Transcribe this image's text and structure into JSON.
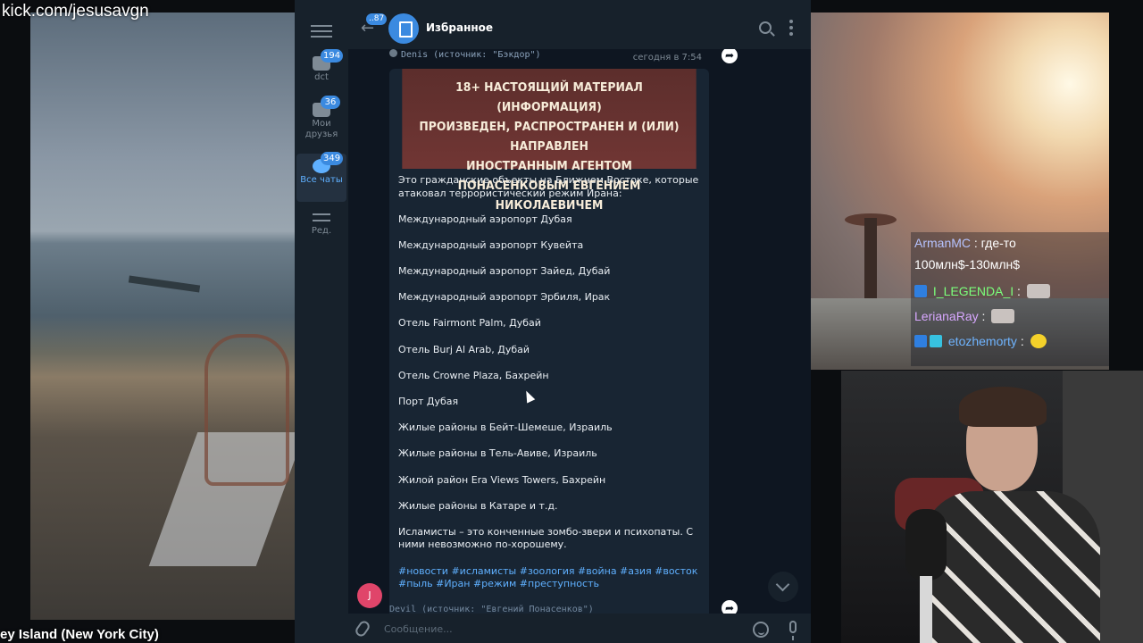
{
  "overlay": {
    "kick_url": "kick.com/jesusavgn",
    "camera_caption": "ey Island (New York City)"
  },
  "stream_chat": [
    {
      "user": "ArmanMC",
      "text": ": где-то"
    },
    {
      "user": "",
      "text": "100млн$-130млн$"
    },
    {
      "user": "I_LEGENDA_I",
      "text": ":"
    },
    {
      "user": "LerianaRay",
      "text": ":"
    },
    {
      "user": "etozhemorty",
      "text": ":"
    }
  ],
  "telegram": {
    "header": {
      "title": "Избранное",
      "back_count": "..87"
    },
    "sidebar": {
      "folders": [
        {
          "label": "dct",
          "count": "194"
        },
        {
          "label": "Мои друзья",
          "count": "36"
        },
        {
          "label": "Все чаты",
          "count": "349"
        },
        {
          "label": "Ред.",
          "count": ""
        }
      ]
    },
    "message": {
      "sender": "Denis (источник: \"Бэкдор\")",
      "time": "сегодня в 7:54",
      "banner": [
        "18+ НАСТОЯЩИЙ МАТЕРИАЛ (ИНФОРМАЦИЯ)",
        "ПРОИЗВЕДЕН, РАСПРОСТРАНЕН И (ИЛИ) НАПРАВЛЕН",
        "ИНОСТРАННЫМ АГЕНТОМ",
        "ПОНАСЕНКОВЫМ ЕВГЕНИЕМ НИКОЛАЕВИЧЕМ"
      ],
      "intro": "Это гражданские объекты на Ближнем Востоке, которые атаковал террористический режим Ирана:",
      "items": [
        "Международный аэропорт Дубая",
        "Международный аэропорт Кувейта",
        "Международный аэропорт Зайед, Дубай",
        "Международный аэропорт Эрбиля, Ирак",
        "Отель Fairmont Palm, Дубай",
        "Отель Burj Al Arab, Дубай",
        "Отель Crowne Plaza, Бахрейн",
        "Порт Дубая",
        "Жилые районы в Бейт-Шемеше, Израиль",
        "Жилые районы в Тель-Авиве, Израиль",
        "Жилой район Era Views Towers, Бахрейн",
        "Жилые районы в Катаре и т.д."
      ],
      "closing": "Исламисты – это конченные зомбо-звери и психопаты. С ними невозможно по-хорошему.",
      "hashtags": "#новости #исламисты #зоология #война #азия #восток #пыль #Иран #режим #преступность"
    },
    "next_message_sender": "Devil (источник: \"Евгений Понасенков\")",
    "user_avatar_letter": "J",
    "input": {
      "placeholder": "Сообщение..."
    }
  },
  "icons": [
    "hamburger-icon",
    "back-arrow-icon",
    "saved-messages-icon",
    "search-icon",
    "more-icon",
    "forward-icon",
    "chevron-down-icon",
    "attach-icon",
    "emoji-icon",
    "mic-icon"
  ]
}
